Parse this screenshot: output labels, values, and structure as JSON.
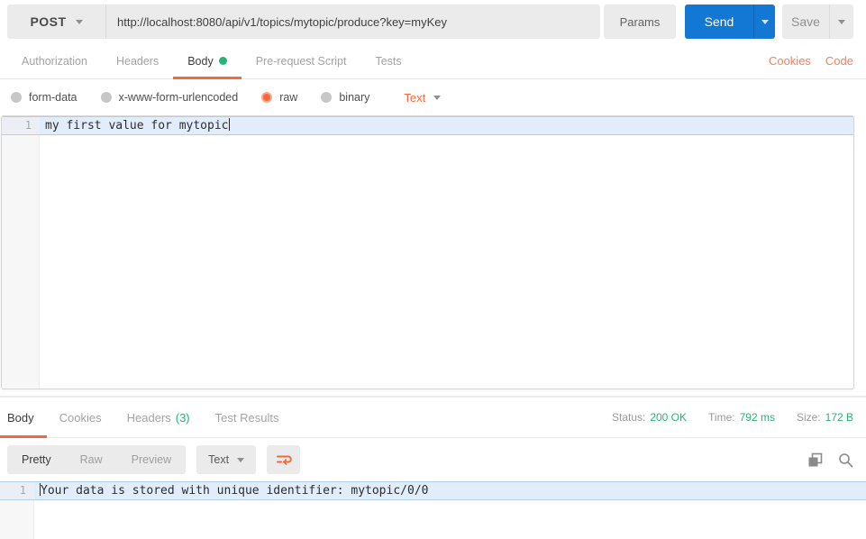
{
  "colors": {
    "accent_orange": "#f4683e",
    "link_orange": "#e98463",
    "send_blue": "#1377d4",
    "status_green": "#26b573"
  },
  "icons": {
    "method_caret": "chevron-down",
    "send_caret": "chevron-down",
    "save_caret": "chevron-down",
    "raw_type_caret": "chevron-down",
    "format_caret": "chevron-down",
    "body_tab_dot": "green-dot",
    "wrap_button": "wrap-text",
    "copy_button": "copy",
    "search_button": "search"
  },
  "request": {
    "method": "POST",
    "url": "http://localhost:8080/api/v1/topics/mytopic/produce?key=myKey",
    "params_label": "Params",
    "send_label": "Send",
    "save_label": "Save",
    "tabs": [
      "Authorization",
      "Headers",
      "Body",
      "Pre-request Script",
      "Tests"
    ],
    "active_tab": "Body",
    "links": {
      "cookies": "Cookies",
      "code": "Code"
    },
    "body_modes": [
      "form-data",
      "x-www-form-urlencoded",
      "raw",
      "binary"
    ],
    "selected_body_mode": "raw",
    "raw_type": "Text",
    "editor": {
      "line_number": "1",
      "line_text": "my first value for mytopic"
    }
  },
  "response": {
    "tabs": {
      "body": "Body",
      "cookies": "Cookies",
      "headers": "Headers",
      "headers_count": "(3)",
      "test_results": "Test Results"
    },
    "active_tab": "Body",
    "meta": {
      "status_label": "Status:",
      "status_value": "200 OK",
      "time_label": "Time:",
      "time_value": "792 ms",
      "size_label": "Size:",
      "size_value": "172 B"
    },
    "view_modes": [
      "Pretty",
      "Raw",
      "Preview"
    ],
    "active_view_mode": "Pretty",
    "format": "Text",
    "editor": {
      "line_number": "1",
      "line_text": "Your data is stored with unique identifier: mytopic/0/0"
    }
  }
}
